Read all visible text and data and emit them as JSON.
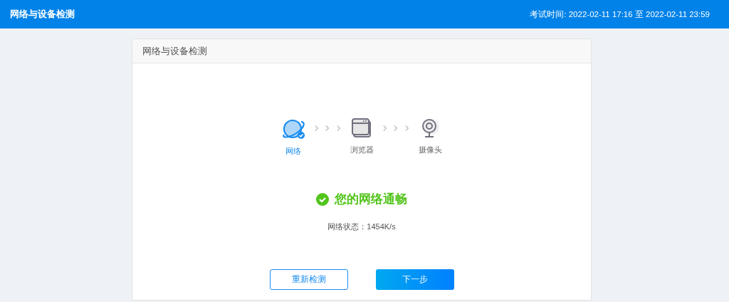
{
  "header": {
    "title": "网络与设备检测",
    "exam_time": "考试时间: 2022-02-11 17:16 至 2022-02-11 23:59"
  },
  "card": {
    "title": "网络与设备检测",
    "steps": [
      {
        "label": "网络",
        "done": true
      },
      {
        "label": "浏览器",
        "done": false
      },
      {
        "label": "摄像头",
        "done": false
      }
    ],
    "result": {
      "ok": true,
      "message": "您的网络通畅",
      "detail": "网络状态：1454K/s"
    },
    "buttons": [
      {
        "label": "重新检测",
        "kind": "outline"
      },
      {
        "label": "下一步",
        "kind": "primary"
      }
    ]
  }
}
